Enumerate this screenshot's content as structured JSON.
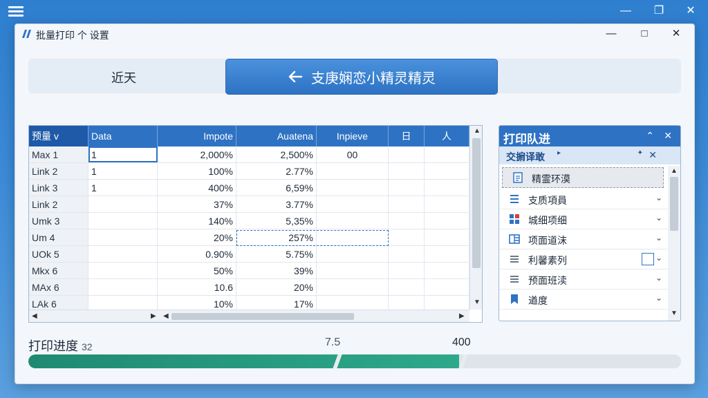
{
  "window": {
    "title": "批量打印 个 设置"
  },
  "topbar": {
    "left_text": "近天",
    "main_button_label": "支庚娴恋小精灵精灵"
  },
  "table": {
    "headers": [
      "预量 v",
      "Data",
      "Impote",
      "Auatena",
      "Inpieve",
      "日",
      "人"
    ],
    "rows": [
      [
        "Max 1",
        "1",
        "2,000%",
        "2,500%",
        "00",
        "",
        ""
      ],
      [
        "Link 2",
        "1",
        "100%",
        "2.77%",
        "",
        "",
        ""
      ],
      [
        "Link 3",
        "1",
        "400%",
        "6,59%",
        "",
        "",
        ""
      ],
      [
        "Link 2",
        "",
        "37%",
        "3.77%",
        "",
        "",
        ""
      ],
      [
        "Umk 3",
        "",
        "140%",
        "5,35%",
        "",
        "",
        ""
      ],
      [
        "Um 4",
        "",
        "20%",
        "257%",
        "",
        "",
        ""
      ],
      [
        "UOk 5",
        "",
        "0.90%",
        "5.75%",
        "",
        "",
        ""
      ],
      [
        "Mkx 6",
        "",
        "50%",
        "39%",
        "",
        "",
        ""
      ],
      [
        "MAx 6",
        "",
        "10.6",
        "20%",
        "",
        "",
        ""
      ],
      [
        "LAk 6",
        "",
        "10%",
        "17%",
        "",
        "",
        ""
      ]
    ]
  },
  "queue": {
    "title": "打印队进",
    "subtitle": "交掮译敢",
    "items": [
      {
        "label": "精霊环漠",
        "icon": "document-icon"
      },
      {
        "label": "支质項員",
        "icon": "list-icon"
      },
      {
        "label": "城细项细",
        "icon": "grid-icon"
      },
      {
        "label": "项面道沫",
        "icon": "page-icon"
      },
      {
        "label": "利馨素列",
        "icon": "lines-icon"
      },
      {
        "label": "预面班渎",
        "icon": "lines-icon"
      },
      {
        "label": "遒度",
        "icon": "bookmark-icon"
      }
    ]
  },
  "progress": {
    "label": "打印进度",
    "current": "32",
    "mid": "7.5",
    "max": "400",
    "fraction": 0.66
  },
  "colors": {
    "accent": "#2e72c4",
    "progress": "#1f8a72"
  }
}
